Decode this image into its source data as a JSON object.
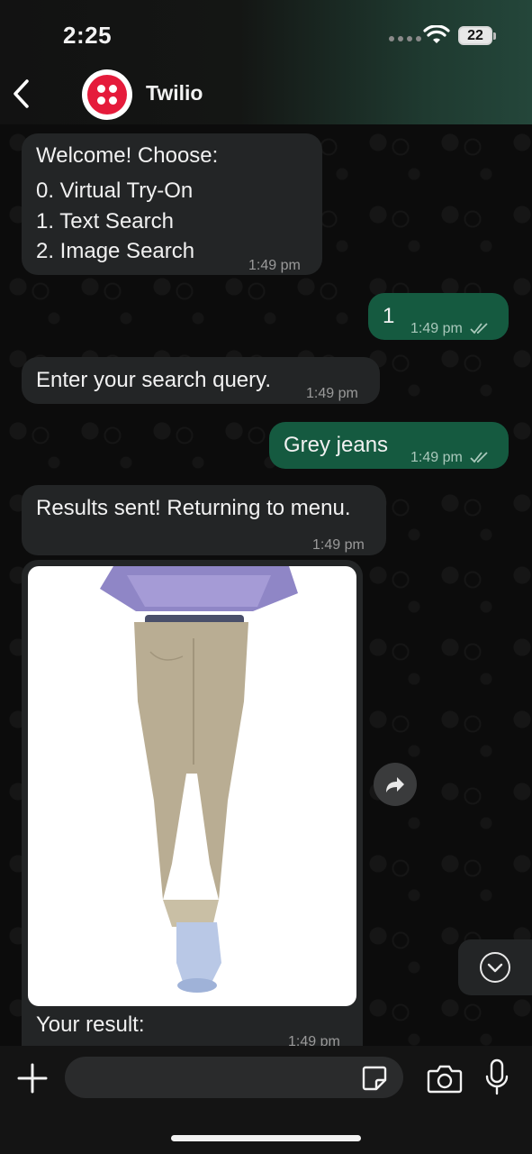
{
  "status_bar": {
    "time": "2:25",
    "battery": "22"
  },
  "header": {
    "contact_name": "Twilio"
  },
  "messages": [
    {
      "direction": "in",
      "lines": [
        "Welcome! Choose:",
        "0. Virtual Try-On",
        "1. Text Search",
        "2. Image Search"
      ],
      "time": "1:49 pm"
    },
    {
      "direction": "out",
      "text": "1",
      "time": "1:49 pm",
      "status": "read"
    },
    {
      "direction": "in",
      "text": "Enter your search query.",
      "time": "1:49 pm"
    },
    {
      "direction": "out",
      "text": "Grey jeans",
      "time": "1:49 pm",
      "status": "read"
    },
    {
      "direction": "in",
      "text": "Results sent! Returning to menu.",
      "time": "1:49 pm"
    },
    {
      "direction": "in",
      "type": "image",
      "caption": "Your result:",
      "time": "1:49 pm"
    }
  ],
  "composer": {
    "placeholder": ""
  },
  "colors": {
    "incoming": "#232526",
    "outgoing": "#155a40",
    "brand": "#e51b3b"
  },
  "icons": [
    "back-icon",
    "wifi-icon",
    "battery-icon",
    "double-check-icon",
    "forward-icon",
    "chevron-down-icon",
    "plus-icon",
    "sticker-icon",
    "camera-icon",
    "mic-icon"
  ]
}
